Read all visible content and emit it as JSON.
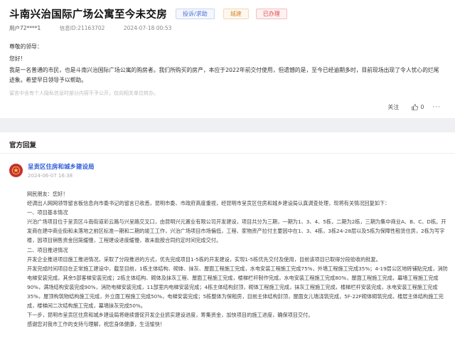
{
  "question": {
    "title": "斗南兴治国际广场公寓至今未交房",
    "tags": {
      "category": "投诉/求助",
      "area": "城建",
      "status": "已办理"
    },
    "user": "用户72****1",
    "letter_id": "信息ID:21163702",
    "time": "2024-07-18 00:53",
    "salutation": "尊敬的领导：",
    "greeting": "您好！",
    "body": "我是一名普通的市民，也是斗南兴治国际广场公寓的购房者。我们所购买的房产，本应于2022年前交付使用，但遗憾的是，至今已经逾期多时，目前现场出现了令人忧心的烂尾迹象。希望早日领导予以帮助。",
    "note": "留言中含有个人隐私信息时部分内容不予公开，仅向相关单位转办。",
    "actions": {
      "follow": "关注",
      "like_count": "0",
      "more": "···"
    }
  },
  "official_reply": {
    "section_title": "官方回复",
    "department": "呈贡区住房和城乡建设局",
    "time": "2024-06-07 16:38",
    "paragraphs": [
      "网民朋友：您好！",
      "经调出人网网领导留言板信息向市委书记的留言已收悉，昆明市委、市政府高度重视，经昆明市呈贡区住房和城乡建设局认真调查处理，现将有关情况回复如下：",
      "一、项目基本情况",
      "兴治广场项目位于呈贡区斗南街道彩云路与兴呈路交叉口，由昆明兴元置业有限公司开发建设，项目共分为三期，一期为1、3、4、5栋，二期为2栋，三期为集中商业A、B、C、D栋。开发商在建中商业街和未落地之前区标准一期和二期的竣工工作，兴治广场项目市场偏低，工程、家物资产拉付主要因中在1、3、4栋，3栋24-28层以及5栋为保障性租赁住房，2栋为写字楼，因项目销售资金回笼缓慢，工程建设进度缓慢，故未能按合同约定时间完成交付。",
      "二、项目推进情况",
      "开发企业推进项目施工推进情况，采取了分段推进的方式，优先完成项目1-5栋的开发建设，实现1-5栋优先交付及使用，目前该项目已取得分段验收的批复。",
      "开发完成时间项目在正常施工建设中，截至目前，1栋主体结构、砌体、抹灰、屋面工程施工完成，水电安装工程施工完成75%，外墙工程施工完成35%；4-19层公区地砖铺贴完成，消防电梯安装完成，其余5部客梯安装完成；2栋主体结构、砌体及抹灰工程、屋面工程施工完成，楼梯栏杆制作完成，水电安装工程施工完成80%，屋面工程施工完成，幕墙工程施工完成90%，满场结构安装完成90%，消防电梯安装完成，11部室内电梯安装完成；4栋主体结构封顶，砌体工程施工完成，抹灰工程施工完成，楼梯栏杆安装完成，水电安装工程施工完成35%，屋顶构筑物结构施工完成，外立面工程施工完成50%，电梯安装完成；5栋整体为保租房，目前主体结构封顶，屋面女儿墙浇筑完成，5F-22F砌体砌筑完成，楼层主体结构施工完成，楼梯间二次结构施工完成，幕墙抹灰完成50%。",
      "下一步，昆明市呈贡区住房和城乡建设局将继续督促开发企业抓实建设进度，筹集资金，加快项目的施工进度，确保项目交付。",
      "感谢您对我市工作的支持与理解，祝您身体健康，生活愉快！"
    ]
  },
  "colors": {
    "accent_blue": "#2f5bd8",
    "status_red": "#e0454a",
    "category_blue": "#4a6fd1",
    "area_orange": "#d98a2c",
    "emblem_red": "#c62f2f"
  },
  "icons": [
    "thumbs-up-icon",
    "government-emblem-icon"
  ]
}
